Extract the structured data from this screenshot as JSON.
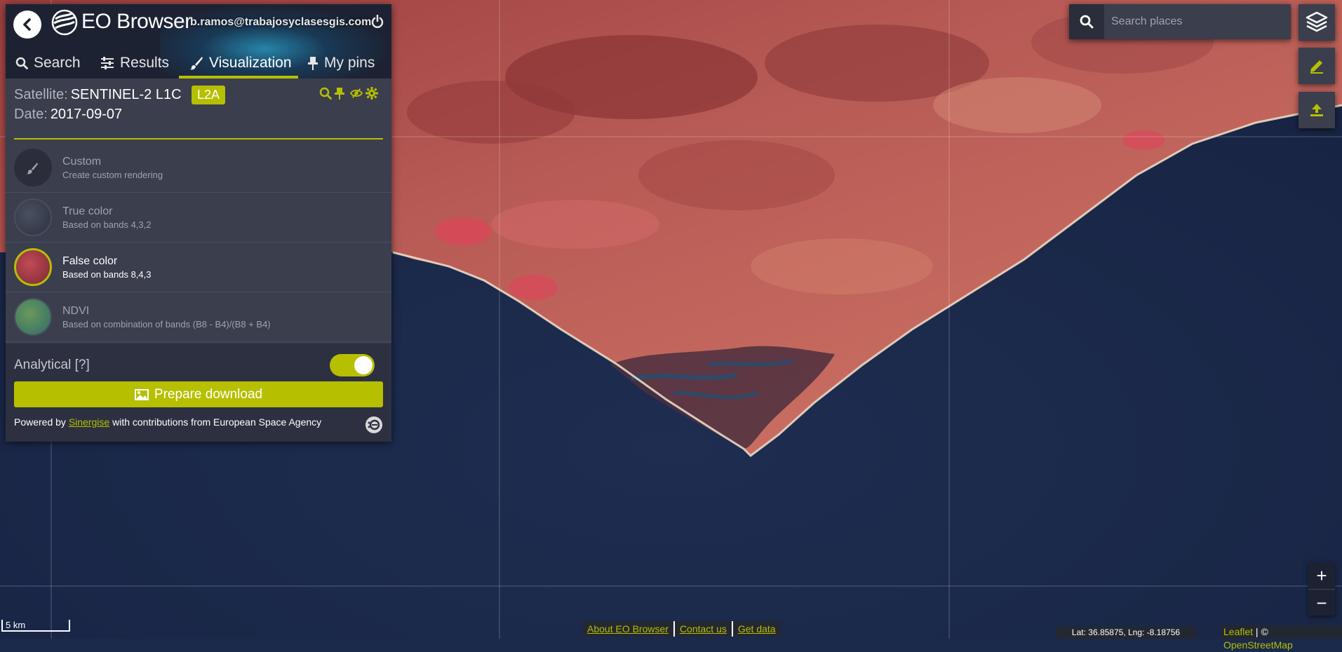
{
  "header": {
    "app_title": "EO Browser",
    "user_email": "b.ramos@trabajosyclasesgis.com"
  },
  "tabs": [
    {
      "label": "Search",
      "icon": "search-icon"
    },
    {
      "label": "Results",
      "icon": "sliders-icon"
    },
    {
      "label": "Visualization",
      "icon": "brush-icon",
      "active": true
    },
    {
      "label": "My pins",
      "icon": "pin-icon"
    }
  ],
  "info": {
    "satellite_label": "Satellite:",
    "satellite_value": "SENTINEL-2 L1C",
    "badge": "L2A",
    "date_label": "Date:",
    "date_value": "2017-09-07"
  },
  "layers": [
    {
      "name": "Custom",
      "description": "Create custom rendering"
    },
    {
      "name": "True color",
      "description": "Based on bands 4,3,2"
    },
    {
      "name": "False color",
      "description": "Based on bands 8,4,3",
      "active": true
    },
    {
      "name": "NDVI",
      "description": "Based on combination of bands (B8 - B4)/(B8 + B4)"
    }
  ],
  "bottom": {
    "analytical_label": "Analytical [?]",
    "analytical_on": true,
    "download_label": "Prepare download",
    "powered_prefix": "Powered by",
    "powered_link": "Sinergise",
    "powered_suffix": "with contributions from European Space Agency"
  },
  "search": {
    "placeholder": "Search places"
  },
  "map": {
    "scale_label": "5 km",
    "zoom_in": "+",
    "zoom_out": "−",
    "coords": "Lat: 36.85875, Lng: -8.18756",
    "footer_links": [
      "About EO Browser",
      "Contact us",
      "Get data"
    ],
    "attribution_leaflet": "Leaflet",
    "attribution_sep": " | © ",
    "attribution_osm": "OpenStreetMap"
  },
  "colors": {
    "accent": "#b6bf00",
    "panel": "#3b3e4c",
    "header": "#1d2233",
    "sea": "#1b2a4a",
    "land": "#b85a55"
  }
}
